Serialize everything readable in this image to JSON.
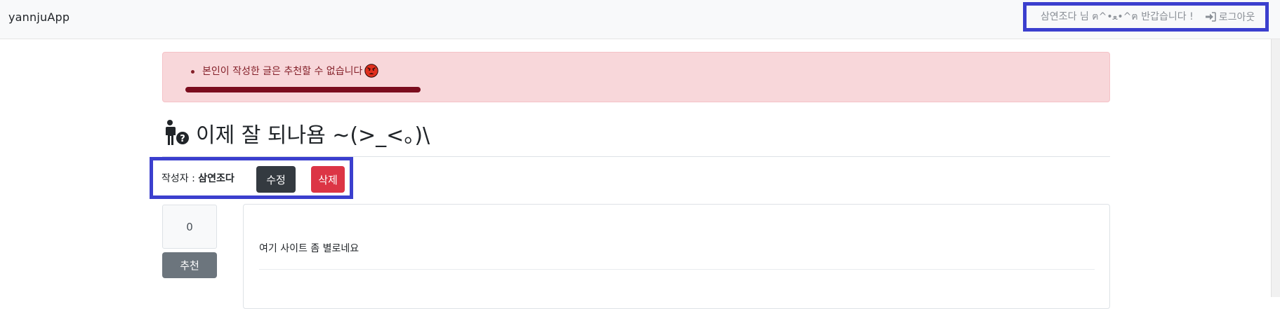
{
  "navbar": {
    "brand": "yannjuApp",
    "greeting": "삼연조다 님 ฅ^•ﻌ•^ฅ 반갑습니다 !",
    "logout_label": "로그아웃"
  },
  "alert": {
    "message": "본인이 작성한 글은 추천할 수 없습니다"
  },
  "post": {
    "title": "이제 잘 되나욤 ~(>_<。)\\",
    "author_label": "작성자 : ",
    "author_name": "삼연조다",
    "edit_label": "수정",
    "delete_label": "삭제",
    "vote_count": "0",
    "vote_label": "추천",
    "content": "여기 사이트 좀 별로네요"
  },
  "icons": {
    "title": "person-question-icon",
    "alert": "angry-face-icon",
    "logout": "sign-in-icon"
  },
  "colors": {
    "highlight_border": "#3b3fce",
    "alert_bg": "#f8d7da",
    "alert_text": "#842029",
    "delete_btn": "#dc3545",
    "edit_btn": "#343a40",
    "vote_btn": "#6c757d"
  }
}
